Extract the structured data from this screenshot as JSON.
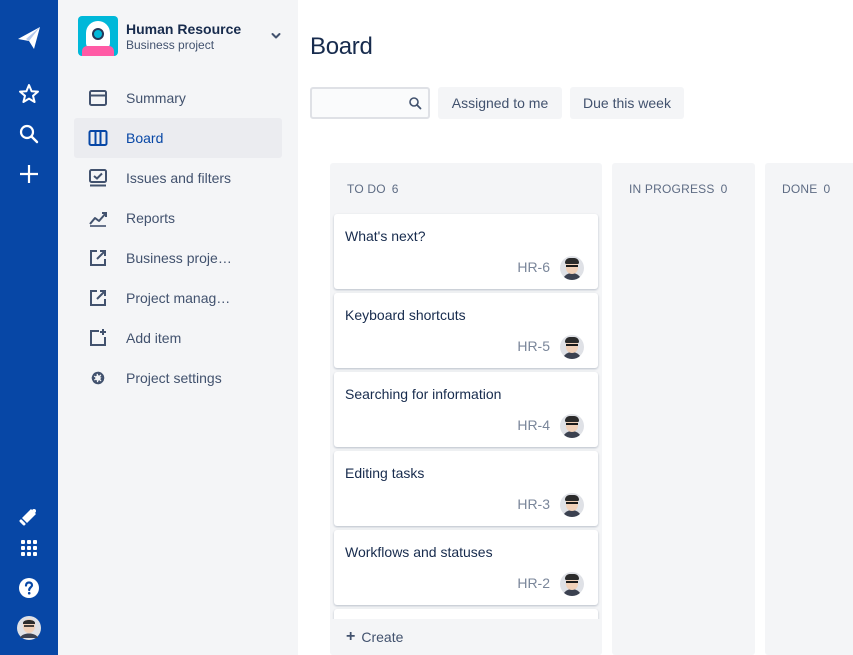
{
  "global_nav": {
    "icons": [
      "product-logo-icon",
      "star-icon",
      "search-icon",
      "plus-icon",
      "notification-icon",
      "app-switcher-icon",
      "help-icon",
      "user-avatar"
    ]
  },
  "project": {
    "name": "Human Resource",
    "type": "Business project"
  },
  "sidebar": {
    "items": [
      {
        "label": "Summary",
        "icon": "summary-icon",
        "active": false
      },
      {
        "label": "Board",
        "icon": "board-icon",
        "active": true
      },
      {
        "label": "Issues and filters",
        "icon": "issues-icon",
        "active": false
      },
      {
        "label": "Reports",
        "icon": "reports-icon",
        "active": false
      },
      {
        "label": "Business proje…",
        "icon": "external-link-icon",
        "active": false
      },
      {
        "label": "Project manag…",
        "icon": "external-link-icon",
        "active": false
      },
      {
        "label": "Add item",
        "icon": "add-item-icon",
        "active": false
      },
      {
        "label": "Project settings",
        "icon": "gear-icon",
        "active": false
      }
    ]
  },
  "board": {
    "title": "Board",
    "search_value": "",
    "filters": {
      "assigned": "Assigned to me",
      "due": "Due this week"
    },
    "columns": [
      {
        "name": "TO DO",
        "count": "6"
      },
      {
        "name": "IN PROGRESS",
        "count": "0"
      },
      {
        "name": "DONE",
        "count": "0"
      }
    ],
    "cards": [
      {
        "title": "What's next?",
        "key": "HR-6"
      },
      {
        "title": "Keyboard shortcuts",
        "key": "HR-5"
      },
      {
        "title": "Searching for information",
        "key": "HR-4"
      },
      {
        "title": "Editing tasks",
        "key": "HR-3"
      },
      {
        "title": "Workflows and statuses",
        "key": "HR-2"
      }
    ],
    "create_label": "Create"
  },
  "colors": {
    "global_nav": "#0747a6",
    "sidebar_bg": "#f4f5f7",
    "active_text": "#0747a6",
    "text": "#172b4d",
    "subtle_text": "#42526e",
    "project_avatar": "#00b8d9"
  }
}
